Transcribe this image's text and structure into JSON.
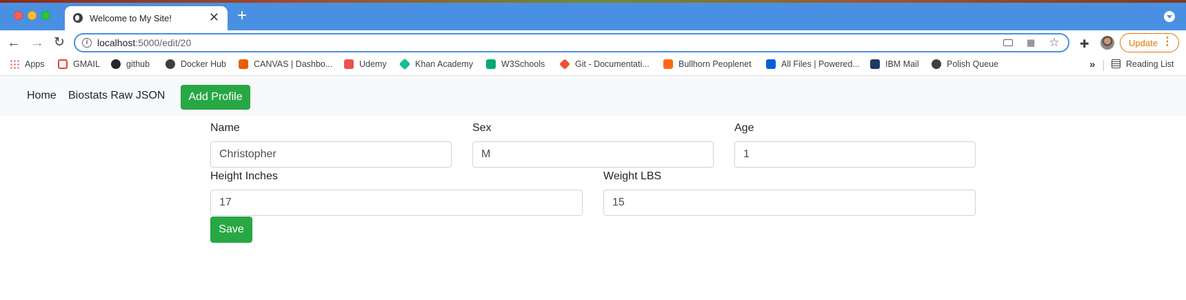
{
  "browser": {
    "tab": {
      "title": "Welcome to My Site!",
      "close_glyph": "✕",
      "favicon": "globe-icon"
    },
    "new_tab_glyph": "+",
    "url": {
      "host": "localhost",
      "path": ":5000/edit/20"
    },
    "update_label": "Update",
    "bookmarks": [
      {
        "label": "Apps",
        "icon": "apps-grid-icon"
      },
      {
        "label": "GMAIL",
        "icon": "gmail-icon"
      },
      {
        "label": "github",
        "icon": "github-icon"
      },
      {
        "label": "Docker Hub",
        "icon": "docker-icon"
      },
      {
        "label": "CANVAS | Dashbo...",
        "icon": "canvas-icon"
      },
      {
        "label": "Udemy",
        "icon": "udemy-icon"
      },
      {
        "label": "Khan Academy",
        "icon": "khan-academy-icon"
      },
      {
        "label": "W3Schools",
        "icon": "w3schools-icon"
      },
      {
        "label": "Git - Documentati...",
        "icon": "git-icon"
      },
      {
        "label": "Bullhorn Peoplenet",
        "icon": "bullhorn-icon"
      },
      {
        "label": "All Files | Powered...",
        "icon": "box-icon"
      },
      {
        "label": "IBM Mail",
        "icon": "ibm-mail-icon"
      },
      {
        "label": "Polish Queue",
        "icon": "globe-icon"
      }
    ],
    "reading_list": "Reading List"
  },
  "navbar": {
    "home": "Home",
    "json": "Biostats Raw JSON",
    "add_profile": "Add Profile"
  },
  "form": {
    "name": {
      "label": "Name",
      "value": "Christopher"
    },
    "sex": {
      "label": "Sex",
      "value": "M"
    },
    "age": {
      "label": "Age",
      "value": "1"
    },
    "height": {
      "label": "Height Inches",
      "value": "17"
    },
    "weight": {
      "label": "Weight LBS",
      "value": "15"
    },
    "save": "Save"
  },
  "colors": {
    "tabstrip": "#4a90e2",
    "success": "#28a745",
    "navbar_bg": "#f8f9fa",
    "update_accent": "#e37400"
  }
}
